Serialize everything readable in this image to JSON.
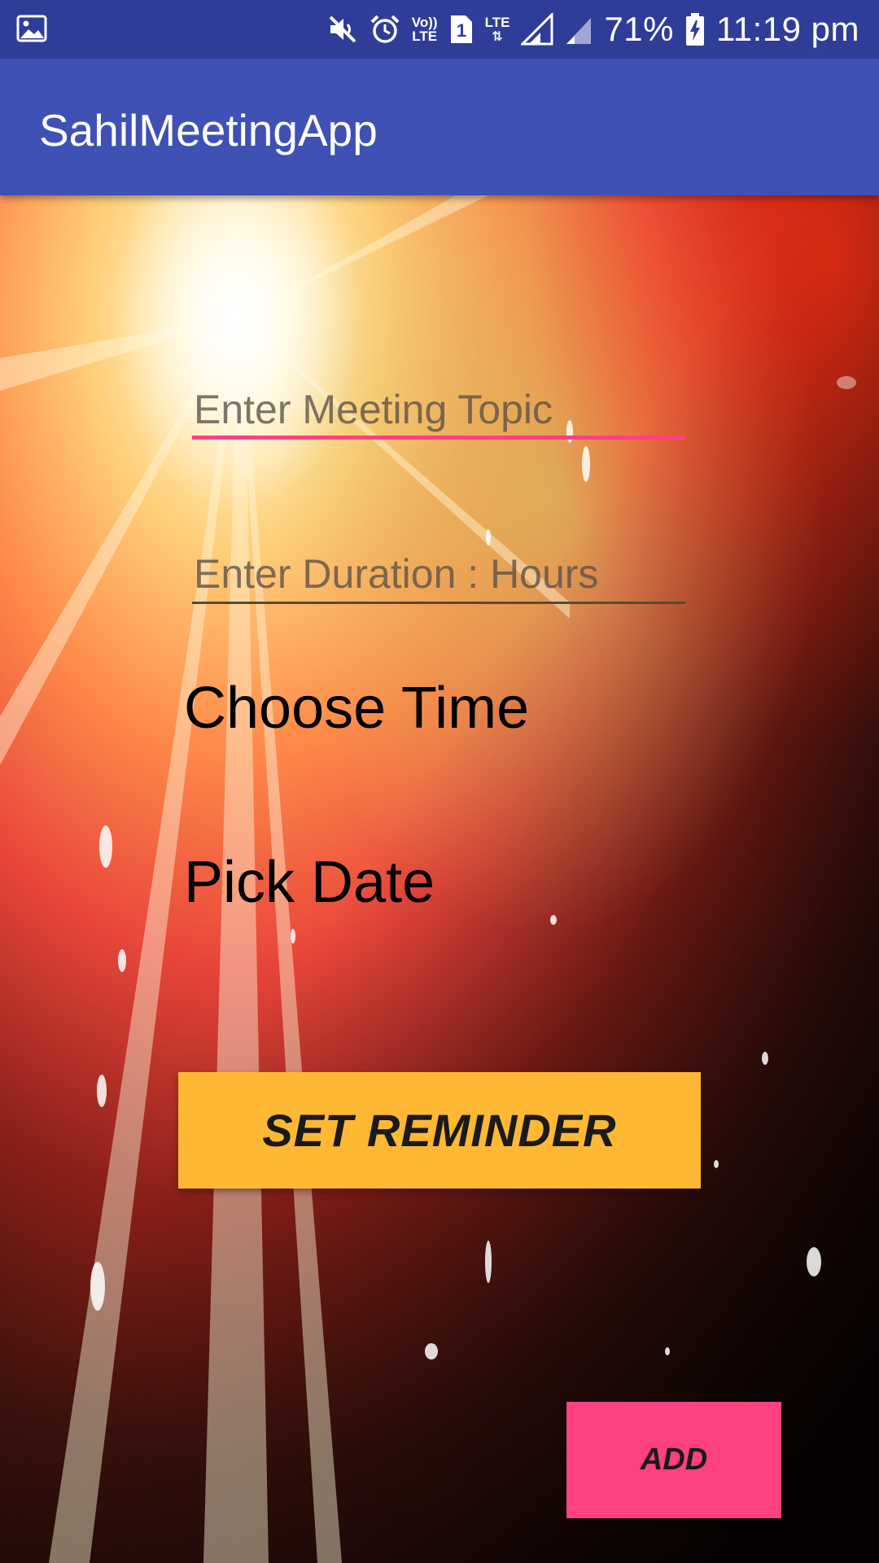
{
  "status_bar": {
    "icons": [
      "image-notification-icon",
      "mute-icon",
      "alarm-icon",
      "volte-icon",
      "sim-1-icon",
      "lte-data-icon",
      "signal-icon",
      "signal-2-icon",
      "battery-charging-icon"
    ],
    "volte_top": "Vo))",
    "volte_bottom": "LTE",
    "sim_slot": "1",
    "lte_label": "LTE",
    "battery": "71%",
    "time": "11:19 pm"
  },
  "app_bar": {
    "title": "SahilMeetingApp",
    "color": "#3f51b5"
  },
  "form": {
    "topic_placeholder": "Enter Meeting Topic",
    "topic_value": "",
    "duration_placeholder": "Enter Duration : Hours",
    "duration_value": "",
    "choose_time_label": "Choose Time",
    "pick_date_label": "Pick Date",
    "set_reminder_label": "SET REMINDER",
    "add_label": "ADD"
  },
  "colors": {
    "status_bar": "#2f3d99",
    "accent": "#ff4081",
    "reminder_button": "#ffb833",
    "add_button": "#ff4081"
  }
}
